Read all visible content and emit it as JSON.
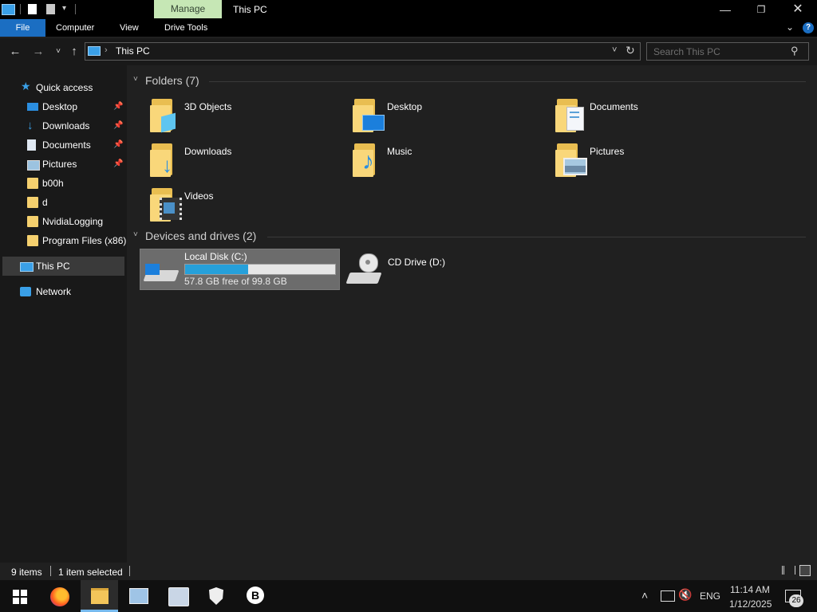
{
  "window": {
    "title": "This PC",
    "manage_tab": "Manage"
  },
  "ribbon": {
    "tabs": [
      "File",
      "Computer",
      "View",
      "Drive Tools"
    ]
  },
  "address": {
    "path": "This PC",
    "search_placeholder": "Search This PC"
  },
  "sidebar": {
    "quick_access": "Quick access",
    "items": [
      {
        "label": "Desktop",
        "pinned": true,
        "icon": "desktop-icon"
      },
      {
        "label": "Downloads",
        "pinned": true,
        "icon": "download-arrow-icon"
      },
      {
        "label": "Documents",
        "pinned": true,
        "icon": "document-icon"
      },
      {
        "label": "Pictures",
        "pinned": true,
        "icon": "pictures-icon"
      },
      {
        "label": "b00h",
        "pinned": false,
        "icon": "folder-icon"
      },
      {
        "label": "d",
        "pinned": false,
        "icon": "folder-icon"
      },
      {
        "label": "NvidiaLogging",
        "pinned": false,
        "icon": "folder-icon"
      },
      {
        "label": "Program Files (x86)",
        "pinned": false,
        "icon": "folder-icon"
      }
    ],
    "this_pc": "This PC",
    "network": "Network"
  },
  "folders": {
    "header": "Folders (7)",
    "items": [
      "3D Objects",
      "Desktop",
      "Documents",
      "Downloads",
      "Music",
      "Pictures",
      "Videos"
    ]
  },
  "devices": {
    "header": "Devices and drives (2)",
    "drives": [
      {
        "name": "Local Disk (C:)",
        "free_text": "57.8 GB free of 99.8 GB",
        "used_fraction": 0.42
      },
      {
        "name": "CD Drive (D:)"
      }
    ]
  },
  "status": {
    "items": "9 items",
    "selected": "1 item selected"
  },
  "taskbar": {
    "lang": "ENG",
    "time": "11:14 AM",
    "date": "1/12/2025",
    "notifications": "26"
  },
  "colors": {
    "accent": "#1b6ec2",
    "manage_tab": "#c6e7b5",
    "drive_bar": "#26a0da",
    "folder": "#f9d77a"
  }
}
